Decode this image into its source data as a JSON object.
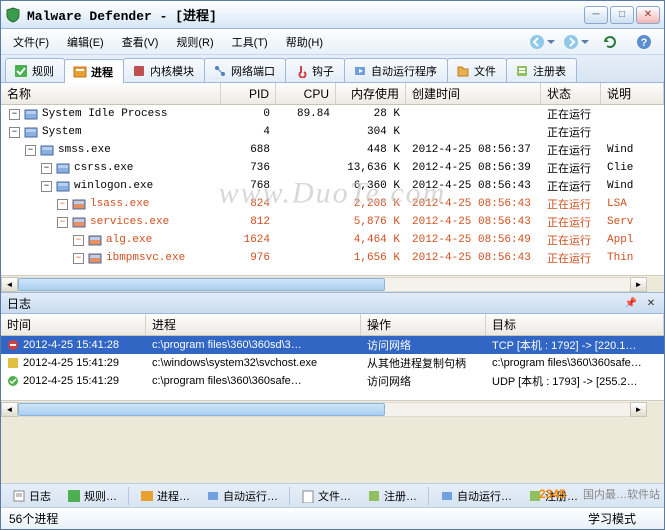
{
  "title": "Malware Defender - [进程]",
  "menus": [
    "文件(F)",
    "编辑(E)",
    "查看(V)",
    "规则(R)",
    "工具(T)",
    "帮助(H)"
  ],
  "tabs": {
    "rules": "规则",
    "processes": "进程",
    "kernel_modules": "内核模块",
    "network_ports": "网络端口",
    "hooks": "钩子",
    "autoruns": "自动运行程序",
    "files": "文件",
    "registry": "注册表"
  },
  "columns": {
    "name": "名称",
    "pid": "PID",
    "cpu": "CPU",
    "mem": "内存使用",
    "time": "创建时间",
    "status": "状态",
    "desc": "说明"
  },
  "processes": [
    {
      "level": 0,
      "name": "System Idle Process",
      "pid": "0",
      "cpu": "89.84",
      "mem": "28 K",
      "time": "",
      "status": "正在运行",
      "desc": "",
      "warn": false
    },
    {
      "level": 0,
      "name": "System",
      "pid": "4",
      "cpu": "",
      "mem": "304 K",
      "time": "",
      "status": "正在运行",
      "desc": "",
      "warn": false
    },
    {
      "level": 1,
      "name": "smss.exe",
      "pid": "688",
      "cpu": "",
      "mem": "448 K",
      "time": "2012-4-25 08:56:37",
      "status": "正在运行",
      "desc": "Wind",
      "warn": false
    },
    {
      "level": 2,
      "name": "csrss.exe",
      "pid": "736",
      "cpu": "",
      "mem": "13,636 K",
      "time": "2012-4-25 08:56:39",
      "status": "正在运行",
      "desc": "Clie",
      "warn": false
    },
    {
      "level": 2,
      "name": "winlogon.exe",
      "pid": "768",
      "cpu": "",
      "mem": "6,360 K",
      "time": "2012-4-25 08:56:43",
      "status": "正在运行",
      "desc": "Wind",
      "warn": false
    },
    {
      "level": 3,
      "name": "lsass.exe",
      "pid": "824",
      "cpu": "",
      "mem": "2,208 K",
      "time": "2012-4-25 08:56:43",
      "status": "正在运行",
      "desc": "LSA",
      "warn": true
    },
    {
      "level": 3,
      "name": "services.exe",
      "pid": "812",
      "cpu": "",
      "mem": "5,876 K",
      "time": "2012-4-25 08:56:43",
      "status": "正在运行",
      "desc": "Serv",
      "warn": true
    },
    {
      "level": 4,
      "name": "alg.exe",
      "pid": "1624",
      "cpu": "",
      "mem": "4,464 K",
      "time": "2012-4-25 08:56:49",
      "status": "正在运行",
      "desc": "Appl",
      "warn": true
    },
    {
      "level": 4,
      "name": "ibmpmsvc.exe",
      "pid": "976",
      "cpu": "",
      "mem": "1,656 K",
      "time": "2012-4-25 08:56:43",
      "status": "正在运行",
      "desc": "Thin",
      "warn": true
    }
  ],
  "watermark": "www.DuoTe.com",
  "log": {
    "title": "日志",
    "columns": {
      "time": "时间",
      "proc": "进程",
      "op": "操作",
      "tgt": "目标"
    },
    "rows": [
      {
        "icon": "block",
        "time": "2012-4-25 15:41:28",
        "proc": "c:\\program files\\360\\360sd\\3…",
        "op": "访问网络",
        "tgt": "TCP [本机 : 1792] -> [220.1…",
        "sel": true
      },
      {
        "icon": "warn",
        "time": "2012-4-25 15:41:29",
        "proc": "c:\\windows\\system32\\svchost.exe",
        "op": "从其他进程复制句柄",
        "tgt": "c:\\program files\\360\\360safe…",
        "sel": false
      },
      {
        "icon": "allow",
        "time": "2012-4-25 15:41:29",
        "proc": "c:\\program files\\360\\360safe…",
        "op": "访问网络",
        "tgt": "UDP [本机 : 1793] -> [255.2…",
        "sel": false
      }
    ]
  },
  "bottom_tabs": {
    "log": "日志",
    "rules": "规则…",
    "processes": "进程…",
    "autoruns": "自动运行…",
    "files": "文件…",
    "registry": "注册…",
    "autoruns2": "自动运行…",
    "registry2": "注册…"
  },
  "footer_text": "国内最…软件站",
  "status": {
    "process_count": "56个进程",
    "mode": "学习模式"
  }
}
